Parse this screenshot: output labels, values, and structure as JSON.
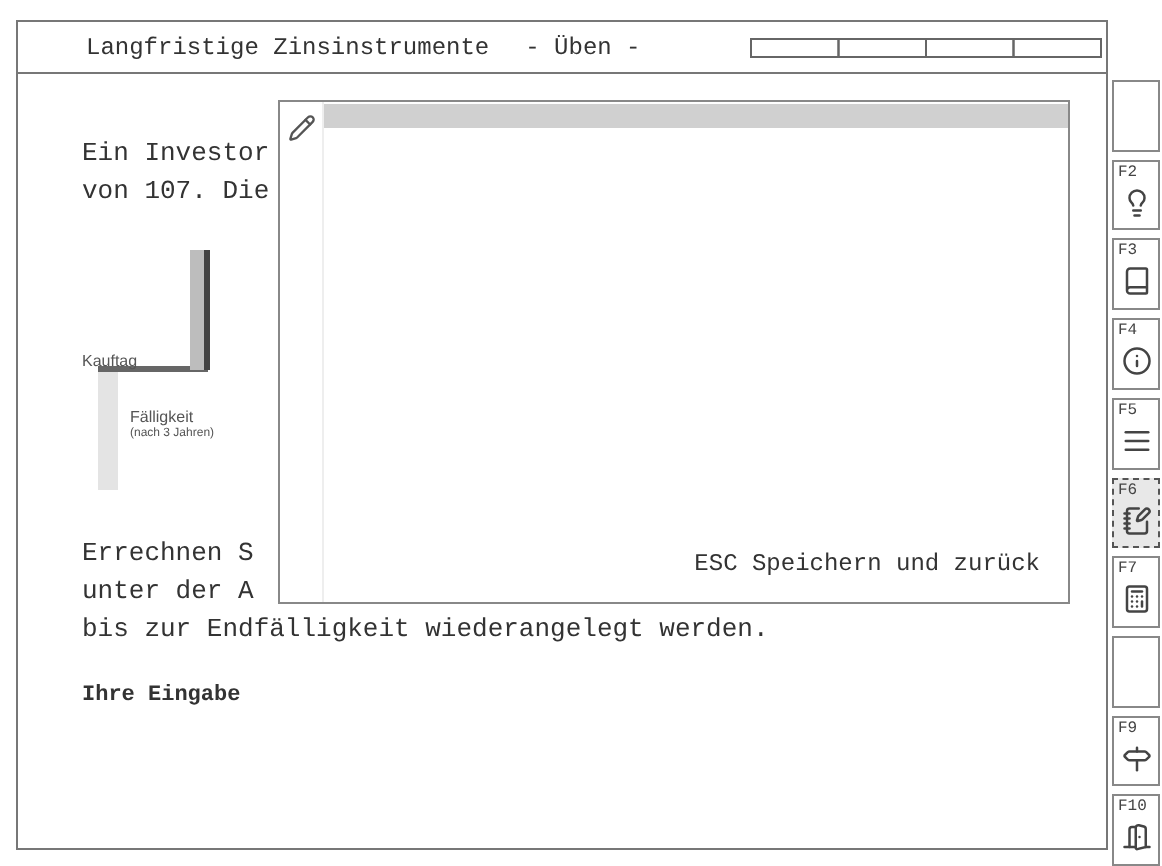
{
  "header": {
    "title": "Langfristige Zinsinstrumente",
    "mode": "- Üben -"
  },
  "lines": [
    "Ein Investor",
    "von 107. Die"
  ],
  "chart": {
    "label_start": "Kauftag",
    "label_end": "Fälligkeit",
    "label_end_note": "(nach 3 Jahren)"
  },
  "lines2": [
    "Errechnen S",
    "unter der A",
    "bis zur Endfälligkeit wiederangelegt werden."
  ],
  "input_label": "Ihre Eingabe",
  "notepad": {
    "footer": "ESC Speichern und zurück"
  },
  "function_keys": [
    {
      "kind": "blank",
      "selected": false
    },
    {
      "kind": "key",
      "key": "F2",
      "selected": false
    },
    {
      "kind": "key",
      "key": "F3",
      "selected": false
    },
    {
      "kind": "key",
      "key": "F4",
      "selected": false
    },
    {
      "kind": "key",
      "key": "F5",
      "selected": false
    },
    {
      "kind": "key",
      "key": "F6",
      "selected": true
    },
    {
      "kind": "key",
      "key": "F7",
      "selected": false
    },
    {
      "kind": "blank",
      "selected": false
    },
    {
      "kind": "key",
      "key": "F9",
      "selected": false
    },
    {
      "kind": "key",
      "key": "F10",
      "selected": false
    }
  ]
}
